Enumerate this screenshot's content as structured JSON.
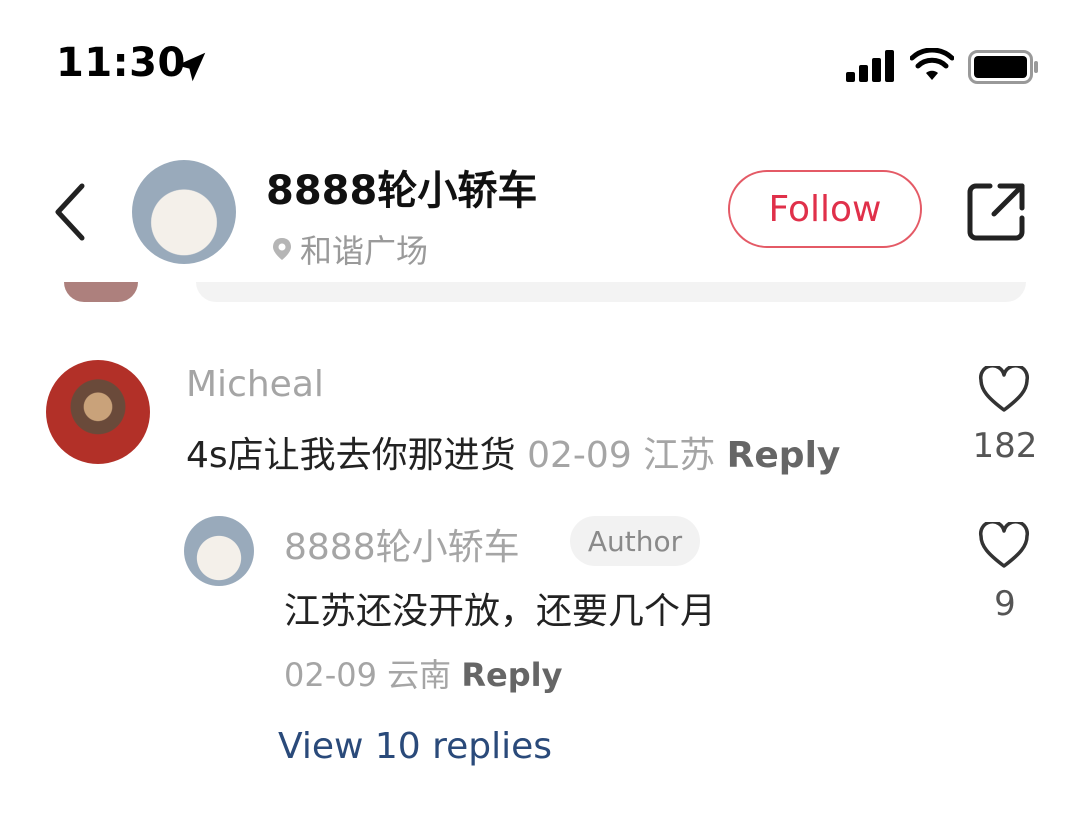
{
  "status_bar": {
    "time": "11:30",
    "icons": [
      "location-arrow-icon",
      "cellular-signal-icon",
      "wifi-icon",
      "battery-icon"
    ]
  },
  "header": {
    "title": "8888轮小轿车",
    "location": "和谐广场",
    "follow_label": "Follow",
    "icons": [
      "back-chevron-icon",
      "share-icon",
      "location-pin-icon"
    ]
  },
  "comment": {
    "username": "Micheal",
    "text": "4s店让我去你那进货",
    "date": "02-09",
    "region": "江苏",
    "reply_label": "Reply",
    "likes": "182"
  },
  "reply": {
    "username": "8888轮小轿车",
    "badge": "Author",
    "text": "江苏还没开放，还要几个月",
    "date": "02-09",
    "region": "云南",
    "reply_label": "Reply",
    "likes": "9"
  },
  "view_replies": "View 10 replies",
  "colors": {
    "accent_red": "#e0304a",
    "link_blue": "#2a4a7a",
    "muted_gray": "#a5a5a5"
  }
}
